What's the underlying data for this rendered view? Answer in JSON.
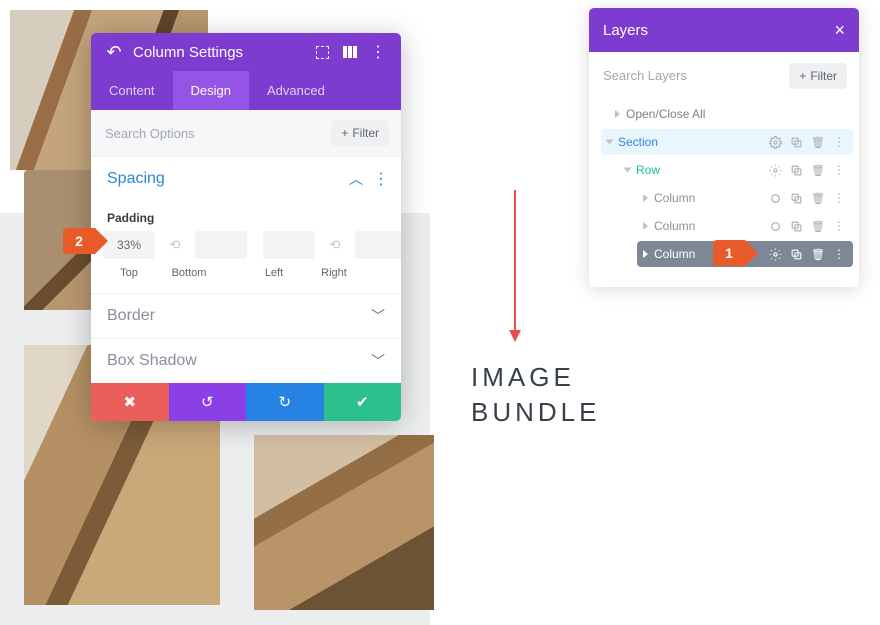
{
  "layers_panel": {
    "title": "Layers",
    "search_placeholder": "Search Layers",
    "filter_label": "Filter",
    "open_close": "Open/Close All",
    "items": {
      "section": "Section",
      "row": "Row",
      "col1": "Column",
      "col2": "Column",
      "col3": "Column"
    }
  },
  "settings_modal": {
    "title": "Column Settings",
    "tabs": {
      "content": "Content",
      "design": "Design",
      "advanced": "Advanced"
    },
    "search_placeholder": "Search Options",
    "filter_label": "Filter",
    "sections": {
      "spacing": "Spacing",
      "border": "Border",
      "box_shadow": "Box Shadow"
    },
    "spacing": {
      "subtitle": "Padding",
      "top_value": "33%",
      "bottom_value": "",
      "left_value": "",
      "right_value": "",
      "labels": {
        "top": "Top",
        "bottom": "Bottom",
        "left": "Left",
        "right": "Right"
      }
    }
  },
  "annotations": {
    "callout1": "1",
    "callout2": "2",
    "image_bundle_l1": "IMAGE",
    "image_bundle_l2": "BUNDLE"
  },
  "colors": {
    "purple": "#7e3bd0",
    "purple_light": "#9554e6",
    "teal": "#2cc08f",
    "blue": "#2783e3",
    "red": "#ea5e5b",
    "orange": "#e85b29"
  }
}
